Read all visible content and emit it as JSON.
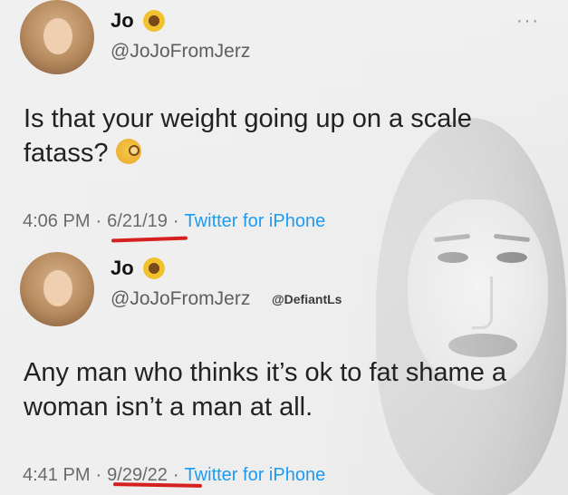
{
  "tweets": [
    {
      "display_name": "Jo",
      "handle": "@JoJoFromJerz",
      "text": "Is that your weight going up on a scale fatass?",
      "time": "4:06 PM",
      "date": "6/21/19",
      "source": "Twitter for iPhone",
      "more_label": "···",
      "emoji": "monocle-face-emoji"
    },
    {
      "display_name": "Jo",
      "handle": "@JoJoFromJerz",
      "text": "Any man who thinks it’s ok to fat shame a woman isn’t a man at all.",
      "time": "4:41 PM",
      "date": "9/29/22",
      "source": "Twitter for iPhone"
    }
  ],
  "watermark": "@DefiantLs",
  "meta_separator": "·",
  "colors": {
    "link": "#1d9bf0",
    "annotation_underline": "#d61f1f",
    "text": "#222222",
    "secondary": "#5f5f5f"
  }
}
